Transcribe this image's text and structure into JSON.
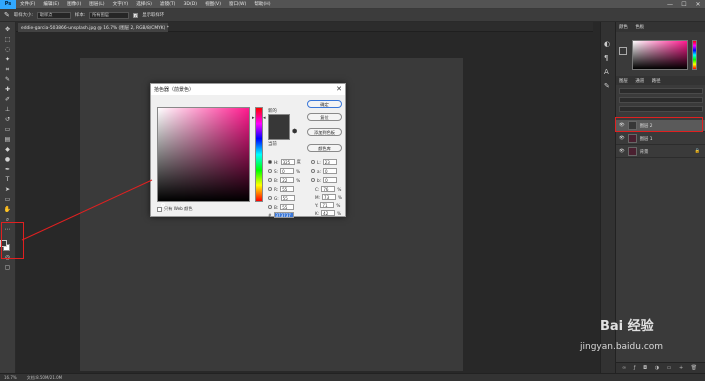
{
  "app": {
    "logo": "Ps"
  },
  "menu": [
    "文件(F)",
    "编辑(E)",
    "图像(I)",
    "图层(L)",
    "文字(Y)",
    "选择(S)",
    "滤镜(T)",
    "3D(D)",
    "视图(V)",
    "窗口(W)",
    "帮助(H)"
  ],
  "window_controls": [
    "—",
    "☐",
    "✕"
  ],
  "options": {
    "size_label": "取样大小:",
    "size_value": "取样点",
    "sample_label": "样本:",
    "sample_value": "所有图层",
    "show_ring_label": "显示取样环"
  },
  "doc_tab": "eddie-garcia-503866-unsplash.jpg @ 16.7% (图层 2, RGB/8/CMYK) *",
  "dialog": {
    "title": "拾色器（前景色）",
    "new_label": "新的",
    "current_label": "当前",
    "buttons": [
      "确定",
      "复位",
      "添加到色板",
      "颜色库"
    ],
    "web_only": "只有 Web 颜色",
    "fields": {
      "H": "325",
      "H_unit": "度",
      "S": "0",
      "S_unit": "%",
      "Bv": "22",
      "Bv_unit": "%",
      "R": "55",
      "G": "55",
      "B": "55",
      "L": "23",
      "a": "0",
      "b": "0",
      "C": "76",
      "M": "73",
      "Y": "71",
      "K": "42",
      "hex": "373737"
    }
  },
  "panels": {
    "top_tabs": [
      "颜色",
      "色板"
    ],
    "layer_tabs": [
      "图层",
      "通道",
      "路径"
    ],
    "layers": [
      {
        "name": "图层 2",
        "selected": true
      },
      {
        "name": "图层 1",
        "selected": false
      },
      {
        "name": "背景",
        "selected": false
      }
    ]
  },
  "status": {
    "zoom": "16.7%",
    "doc": "文档:8.50M/21.0M"
  },
  "watermark": {
    "brand": "Bai 经验",
    "url": "jingyan.baidu.com"
  },
  "colors": {
    "accent": "#31a8ff",
    "annotation": "#e02020"
  }
}
